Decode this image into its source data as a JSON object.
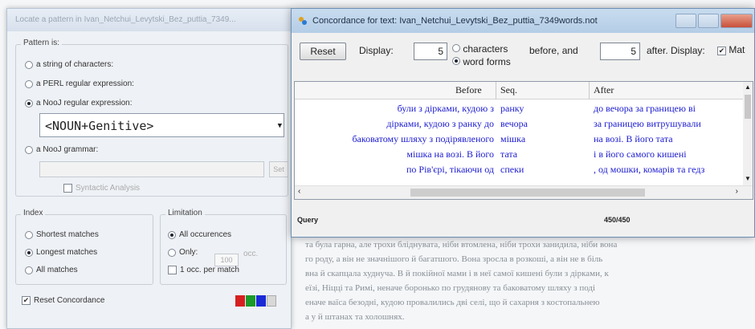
{
  "locate_window": {
    "title": "Locate a pattern in Ivan_Netchui_Levytski_Bez_puttia_7349...",
    "pattern_group_label": "Pattern is:",
    "option_string": "a string of characters:",
    "option_perl": "a PERL regular expression:",
    "option_nooj_regex": "a NooJ regular expression:",
    "pattern_value": "<NOUN+Genitive>",
    "option_grammar": "a NooJ grammar:",
    "set_button": "Set",
    "syntactic_analysis": "Syntactic Analysis",
    "index_group_label": "Index",
    "index_shortest": "Shortest matches",
    "index_longest": "Longest matches",
    "index_all": "All matches",
    "limitation_group_label": "Limitation",
    "limit_all": "All occurences",
    "limit_only": "Only:",
    "limit_only_value": "100",
    "limit_only_unit": "occ.",
    "limit_one_per_match": "1 occ. per match",
    "reset_concordance": "Reset Concordance",
    "color_buttons": [
      "#d62020",
      "#1a9a2a",
      "#1a2ad6",
      "#d8d8d8"
    ]
  },
  "concordance_window": {
    "title": "Concordance for text: Ivan_Netchui_Levytski_Bez_puttia_7349words.not",
    "reset_button": "Reset",
    "display_label": "Display:",
    "before_count": "5",
    "unit_characters": "characters",
    "unit_word_forms": "word forms",
    "before_and_label": "before, and",
    "after_count": "5",
    "after_label": "after. Display:",
    "matches_label": "Mat",
    "columns": {
      "before": "Before",
      "seq": "Seq.",
      "after": "After"
    },
    "rows": [
      {
        "before": "були з дірками, кудою з",
        "seq": "ранку",
        "after": "до вечора за границею ві"
      },
      {
        "before": "дірками, кудою з ранку до",
        "seq": "вечора",
        "after": "за границею витрушували"
      },
      {
        "before": "баковатому шляху з подірявленого",
        "seq": "мішка",
        "after": "на возі. В його тата"
      },
      {
        "before": "мішка на возі. В його",
        "seq": "тата",
        "after": "і в його самого кишені"
      },
      {
        "before": "по Рів'єрі, тікаючи од",
        "seq": "спеки",
        "after": ", од мошки, комарів та гедз"
      }
    ],
    "status_label": "Query",
    "status_count": "450/450"
  },
  "background_text": [
    "та була гарна, але трохи бліднувата, ніби втомлена, ніби трохи занидила, ніби вона",
    "го роду, а він не значнішого й багатшого. Вона зросла в розкоші, а він не в біль",
    "вна й скапцала худнуча. В й покійної мами і в неї самої кишені були з дірками, к",
    "еїзі, Ніцці та Римі, неначе боронько по грудянову та баковатому шляху з поді",
    "еначе ваїса безодні, кудою провалились дві селі, що й сахарня з костопальнею",
    "а у й штанах та холошнях."
  ]
}
